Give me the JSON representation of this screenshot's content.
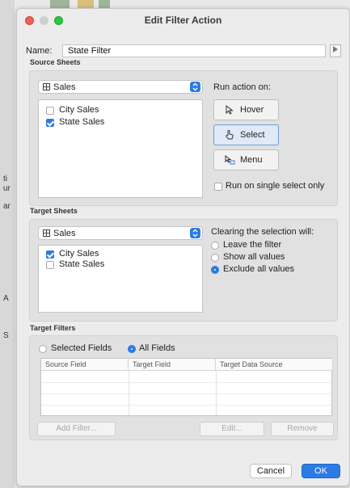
{
  "window": {
    "title": "Edit Filter Action"
  },
  "name": {
    "label": "Name:",
    "value": "State Filter"
  },
  "source_sheets": {
    "label": "Source Sheets",
    "dropdown_value": "Sales",
    "items": [
      {
        "label": "City Sales",
        "checked": false
      },
      {
        "label": "State Sales",
        "checked": true
      }
    ]
  },
  "run_action": {
    "label": "Run action on:",
    "buttons": [
      {
        "label": "Hover",
        "selected": false
      },
      {
        "label": "Select",
        "selected": true
      },
      {
        "label": "Menu",
        "selected": false
      }
    ],
    "single_select_label": "Run on single select only",
    "single_select_checked": false
  },
  "target_sheets": {
    "label": "Target Sheets",
    "dropdown_value": "Sales",
    "items": [
      {
        "label": "City Sales",
        "checked": true
      },
      {
        "label": "State Sales",
        "checked": false
      }
    ]
  },
  "clearing": {
    "label": "Clearing the selection will:",
    "options": [
      {
        "label": "Leave the filter",
        "selected": false
      },
      {
        "label": "Show all values",
        "selected": false
      },
      {
        "label": "Exclude all values",
        "selected": true
      }
    ]
  },
  "target_filters": {
    "label": "Target Filters",
    "options": [
      {
        "label": "Selected Fields",
        "selected": false
      },
      {
        "label": "All Fields",
        "selected": true
      }
    ],
    "columns": [
      "Source Field",
      "Target Field",
      "Target Data Source"
    ],
    "buttons": {
      "add": "Add Filter...",
      "edit": "Edit...",
      "remove": "Remove"
    }
  },
  "footer": {
    "cancel": "Cancel",
    "ok": "OK"
  },
  "colors": {
    "accent": "#2c7be5",
    "close": "#ee5d56",
    "zoom": "#28c840"
  },
  "background": {
    "glyphs": [
      "ti",
      "ur",
      "ar",
      "A",
      "S"
    ]
  }
}
